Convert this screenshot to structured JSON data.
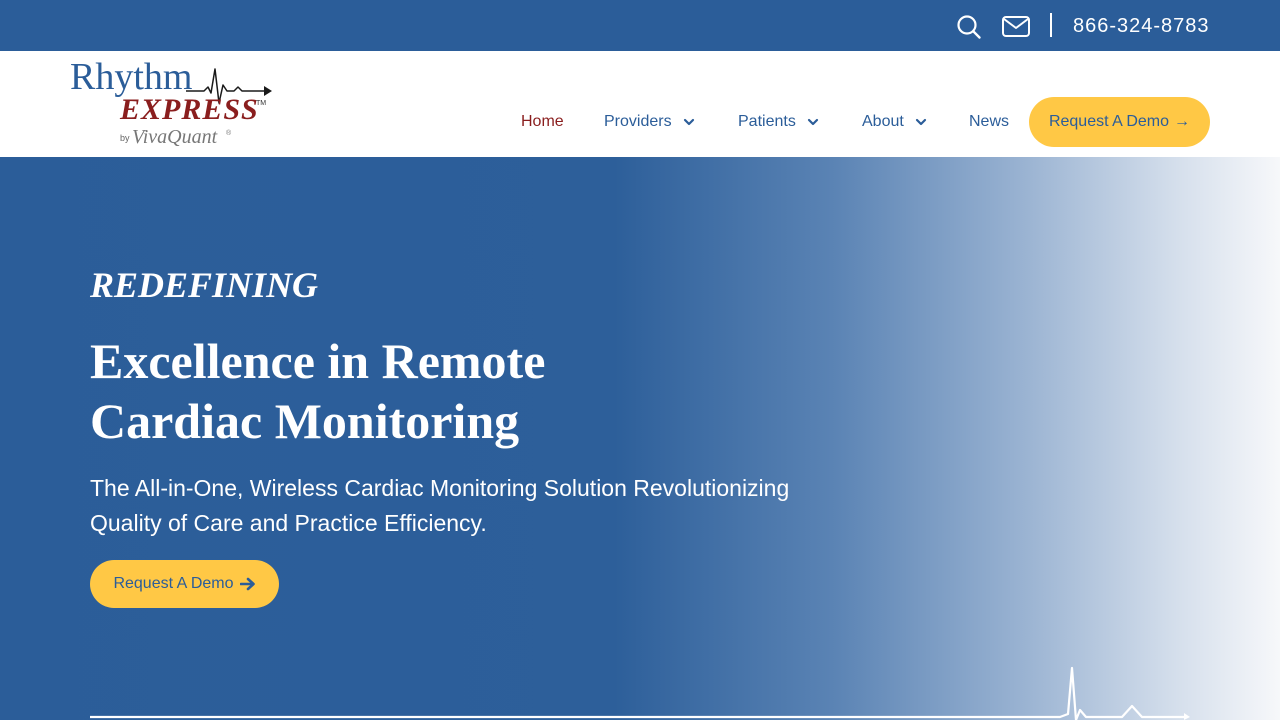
{
  "topbar": {
    "search_icon": "search-icon",
    "mail_icon": "mail-icon",
    "phone": "866-324-8783"
  },
  "header": {
    "logo": {
      "brand_line1": "Rhythm",
      "brand_line2": "EXPRESS",
      "trademark": "TM",
      "by_line_prefix": "by",
      "by_line_brand": "VivaQuant",
      "registered": "®"
    },
    "nav": {
      "home": "Home",
      "providers": "Providers",
      "patients": "Patients",
      "about": "About",
      "news": "News"
    },
    "cta": {
      "label": "Request A Demo",
      "arrow": "→"
    }
  },
  "hero": {
    "eyebrow": "REDEFINING",
    "headline_line1": "Excellence in Remote",
    "headline_line2": "Cardiac Monitoring",
    "subhead_line1": "The All-in-One, Wireless Cardiac Monitoring Solution Revolutionizing",
    "subhead_line2": "Quality of Care and Practice Efficiency.",
    "cta_label": "Request A Demo",
    "cta_icon": "arrow-right-icon"
  },
  "colors": {
    "brand_blue": "#2b5d99",
    "accent_yellow": "#ffc845",
    "active_nav": "#8a1e1e",
    "logo_red": "#8a1e1e"
  }
}
